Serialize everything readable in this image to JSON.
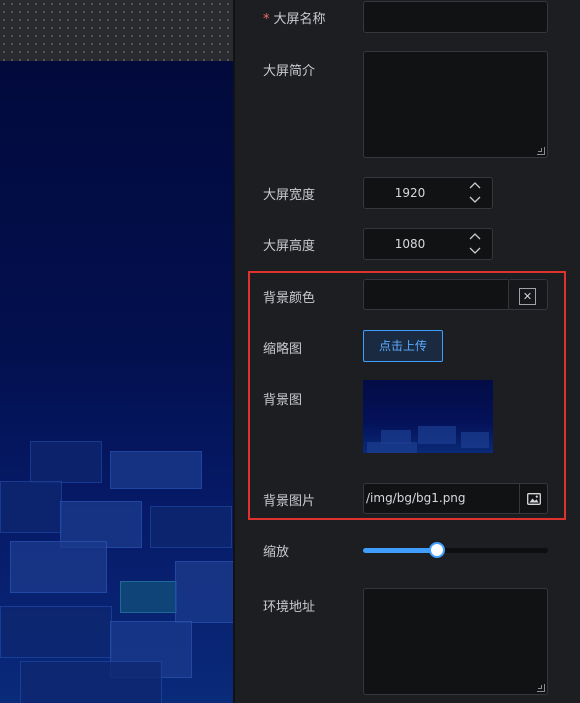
{
  "form": {
    "name_label": "大屏名称",
    "required_mark": "*",
    "name_value": "",
    "intro_label": "大屏简介",
    "intro_value": "",
    "width_label": "大屏宽度",
    "width_value": "1920",
    "height_label": "大屏高度",
    "height_value": "1080",
    "bg_color_label": "背景颜色",
    "bg_color_value": "",
    "thumbnail_label": "缩略图",
    "upload_button": "点击上传",
    "bg_image_label": "背景图",
    "bg_image_path_label": "背景图片",
    "bg_image_path_value": "/img/bg/bg1.png",
    "scale_label": "缩放",
    "scale_value": 0.4,
    "env_url_label": "环境地址",
    "env_url_value": ""
  },
  "colors": {
    "accent": "#409eff",
    "highlight": "#e0322d",
    "required": "#f56c6c"
  }
}
